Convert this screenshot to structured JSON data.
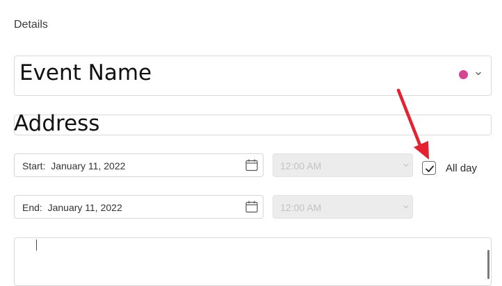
{
  "details": {
    "label": "Details"
  },
  "event_name": {
    "value": "Event Name",
    "color": "#d64591"
  },
  "address": {
    "value": "Address"
  },
  "start": {
    "label": "Start:",
    "date": "January 11, 2022",
    "text": "Start:  January 11, 2022",
    "time": "12:00 AM"
  },
  "end": {
    "label": "End:",
    "date": "January 11, 2022",
    "text": "End:  January 11, 2022",
    "time": "12:00 AM"
  },
  "all_day": {
    "label": "All day",
    "checked": true
  },
  "colors": {
    "annotation_arrow": "#e32130",
    "event_color": "#d64591"
  },
  "icons": {
    "calendar": "calendar-icon",
    "chevron": "chevron-down-icon",
    "check": "checkmark-icon"
  }
}
